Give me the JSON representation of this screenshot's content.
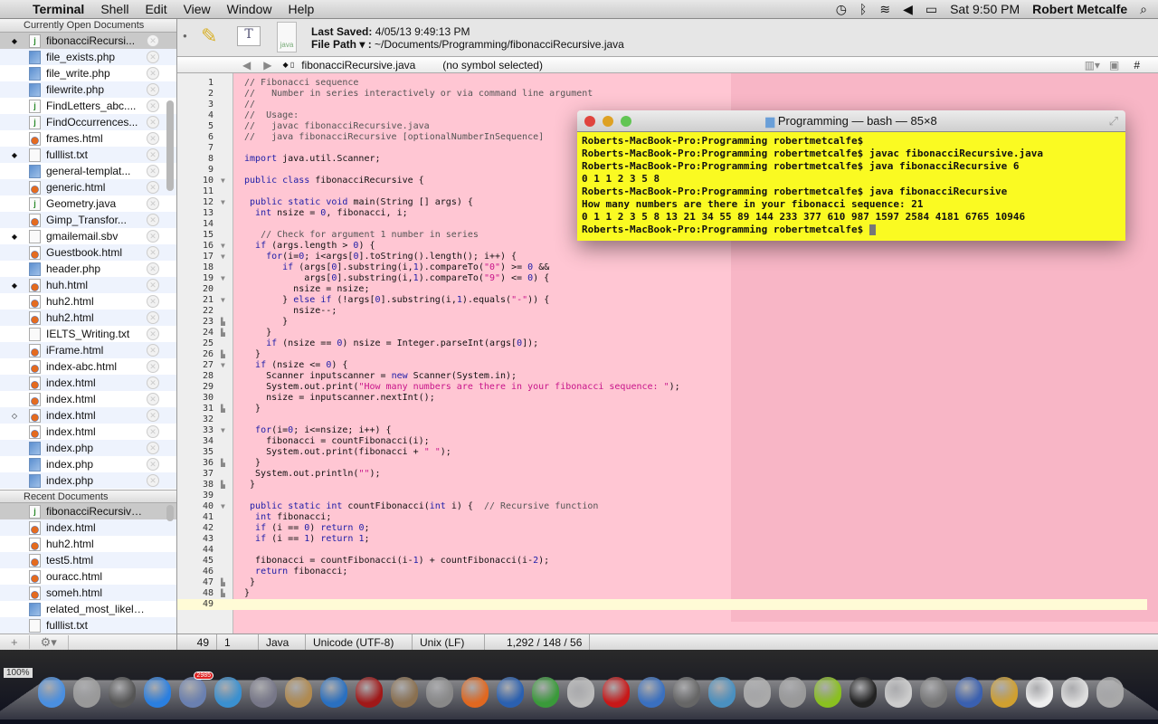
{
  "menubar": {
    "app": "Terminal",
    "items": [
      "Shell",
      "Edit",
      "View",
      "Window",
      "Help"
    ],
    "clock": "Sat 9:50 PM",
    "user": "Robert Metcalfe"
  },
  "sidebar": {
    "open_header": "Currently Open Documents",
    "open_docs": [
      {
        "name": "fibonacciRecursi...",
        "type": "java",
        "mark": "◆",
        "selected": true
      },
      {
        "name": "file_exists.php",
        "type": "php",
        "mark": ""
      },
      {
        "name": "file_write.php",
        "type": "php",
        "mark": ""
      },
      {
        "name": "filewrite.php",
        "type": "php",
        "mark": ""
      },
      {
        "name": "FindLetters_abc....",
        "type": "java",
        "mark": ""
      },
      {
        "name": "FindOccurrences...",
        "type": "java",
        "mark": ""
      },
      {
        "name": "frames.html",
        "type": "html",
        "mark": ""
      },
      {
        "name": "fulllist.txt",
        "type": "txt",
        "mark": "◆"
      },
      {
        "name": "general-templat...",
        "type": "php",
        "mark": ""
      },
      {
        "name": "generic.html",
        "type": "html",
        "mark": ""
      },
      {
        "name": "Geometry.java",
        "type": "java",
        "mark": ""
      },
      {
        "name": "Gimp_Transfor...",
        "type": "html",
        "mark": ""
      },
      {
        "name": "gmailemail.sbv",
        "type": "txt",
        "mark": "◆"
      },
      {
        "name": "Guestbook.html",
        "type": "html",
        "mark": ""
      },
      {
        "name": "header.php",
        "type": "php",
        "mark": ""
      },
      {
        "name": "huh.html",
        "type": "html",
        "mark": "◆"
      },
      {
        "name": "huh2.html",
        "type": "html",
        "mark": ""
      },
      {
        "name": "huh2.html",
        "type": "html",
        "mark": ""
      },
      {
        "name": "IELTS_Writing.txt",
        "type": "txt",
        "mark": ""
      },
      {
        "name": "iFrame.html",
        "type": "html",
        "mark": ""
      },
      {
        "name": "index-abc.html",
        "type": "html",
        "mark": ""
      },
      {
        "name": "index.html",
        "type": "html",
        "mark": ""
      },
      {
        "name": "index.html",
        "type": "html",
        "mark": ""
      },
      {
        "name": "index.html",
        "type": "html",
        "mark": "◇"
      },
      {
        "name": "index.html",
        "type": "html",
        "mark": ""
      },
      {
        "name": "index.php",
        "type": "php",
        "mark": ""
      },
      {
        "name": "index.php",
        "type": "php",
        "mark": ""
      },
      {
        "name": "index.php",
        "type": "php",
        "mark": ""
      }
    ],
    "recent_header": "Recent Documents",
    "recent_docs": [
      {
        "name": "fibonacciRecursive.j...",
        "type": "java",
        "selected": true
      },
      {
        "name": "index.html",
        "type": "html"
      },
      {
        "name": "huh2.html",
        "type": "html"
      },
      {
        "name": "test5.html",
        "type": "html"
      },
      {
        "name": "ouracc.html",
        "type": "html"
      },
      {
        "name": "someh.html",
        "type": "html"
      },
      {
        "name": "related_most_likely_...",
        "type": "php"
      },
      {
        "name": "fulllist.txt",
        "type": "txt"
      }
    ],
    "footer": {
      "add": "+",
      "gear": "⚙▾"
    }
  },
  "toolbar": {
    "last_saved_label": "Last Saved:",
    "last_saved": "4/05/13 9:49:13 PM",
    "file_path_label": "File Path ▾ :",
    "file_path": "~/Documents/Programming/fibonacciRecursive.java",
    "file_icon_text": "java"
  },
  "navbar": {
    "file": "fibonacciRecursive.java",
    "symbol": "(no symbol selected)",
    "hash": "#"
  },
  "editor": {
    "bg_color": "#ffc6d3",
    "fold_open": [
      10,
      12,
      16,
      17,
      19,
      21,
      27,
      33,
      40
    ],
    "fold_close": [
      23,
      24,
      26,
      31,
      36,
      38,
      47,
      48
    ],
    "current_line": 49,
    "lines": [
      "// Fibonacci sequence",
      "//   Number in series interactively or via command line argument",
      "//",
      "//  Usage:",
      "//   javac fibonacciRecursive.java",
      "//   java fibonacciRecursive [optionalNumberInSequence]",
      "",
      "import java.util.Scanner;",
      "",
      "public class fibonacciRecursive {",
      "",
      " public static void main(String [] args) {",
      "  int nsize = 0, fibonacci, i;",
      "",
      "   // Check for argument 1 number in series",
      "  if (args.length > 0) {",
      "    for(i=0; i<args[0].toString().length(); i++) {",
      "       if (args[0].substring(i,1).compareTo(\"0\") >= 0 &&",
      "           args[0].substring(i,1).compareTo(\"9\") <= 0) {",
      "         nsize = nsize;",
      "       } else if (!args[0].substring(i,1).equals(\"-\")) {",
      "         nsize--;",
      "       }",
      "    }",
      "    if (nsize == 0) nsize = Integer.parseInt(args[0]);",
      "  }",
      "  if (nsize <= 0) {",
      "    Scanner inputscanner = new Scanner(System.in);",
      "    System.out.print(\"How many numbers are there in your fibonacci sequence: \");",
      "    nsize = inputscanner.nextInt();",
      "  }",
      "",
      "  for(i=0; i<=nsize; i++) {",
      "    fibonacci = countFibonacci(i);",
      "    System.out.print(fibonacci + \" \");",
      "  }",
      "  System.out.println(\"\");",
      " }",
      "",
      " public static int countFibonacci(int i) {  // Recursive function",
      "  int fibonacci;",
      "  if (i == 0) return 0;",
      "  if (i == 1) return 1;",
      "",
      "  fibonacci = countFibonacci(i-1) + countFibonacci(i-2);",
      "  return fibonacci;",
      " }",
      "}",
      ""
    ]
  },
  "status": {
    "line": "49",
    "col": "1",
    "language": "Java",
    "encoding": "Unicode (UTF-8)",
    "line_endings": "Unix (LF)",
    "counts": "1,292 / 148 / 56"
  },
  "terminal": {
    "title": "Programming — bash — 85×8",
    "bg_color": "#fafa22",
    "lines": [
      "Roberts-MacBook-Pro:Programming robertmetcalfe$",
      "Roberts-MacBook-Pro:Programming robertmetcalfe$ javac fibonacciRecursive.java",
      "Roberts-MacBook-Pro:Programming robertmetcalfe$ java fibonacciRecursive 6",
      "0 1 1 2 3 5 8",
      "Roberts-MacBook-Pro:Programming robertmetcalfe$ java fibonacciRecursive",
      "How many numbers are there in your fibonacci sequence: 21",
      "0 1 1 2 3 5 8 13 21 34 55 89 144 233 377 610 987 1597 2584 4181 6765 10946",
      "Roberts-MacBook-Pro:Programming robertmetcalfe$ "
    ]
  },
  "dock": {
    "zoom": "100%",
    "badge": "2985",
    "apps": [
      {
        "name": "finder",
        "color": "#4a8fe0"
      },
      {
        "name": "launchpad",
        "color": "#999"
      },
      {
        "name": "app",
        "color": "#555"
      },
      {
        "name": "app-store",
        "color": "#2a7fe0"
      },
      {
        "name": "mail-stamp",
        "color": "#6a80b0",
        "badge": true
      },
      {
        "name": "safari",
        "color": "#3a90d0"
      },
      {
        "name": "facetime",
        "color": "#778"
      },
      {
        "name": "address-book",
        "color": "#b08a50"
      },
      {
        "name": "itunes",
        "color": "#2a70c0"
      },
      {
        "name": "photo-booth",
        "color": "#a01818"
      },
      {
        "name": "iphoto",
        "color": "#8a7050"
      },
      {
        "name": "system-preferences",
        "color": "#888"
      },
      {
        "name": "firefox",
        "color": "#e06820"
      },
      {
        "name": "filezilla",
        "color": "#2a60b0"
      },
      {
        "name": "chrome",
        "color": "#3a9a3a"
      },
      {
        "name": "scissors-app",
        "color": "#bbb"
      },
      {
        "name": "opera",
        "color": "#c81818"
      },
      {
        "name": "xcode",
        "color": "#3a70c0"
      },
      {
        "name": "gimp",
        "color": "#666"
      },
      {
        "name": "preview",
        "color": "#4a90c0"
      },
      {
        "name": "help",
        "color": "#aaa"
      },
      {
        "name": "eclipse",
        "color": "#999"
      },
      {
        "name": "brackets",
        "color": "#8ac020"
      },
      {
        "name": "terminal",
        "color": "#222"
      },
      {
        "name": "automator",
        "color": "#ccc"
      },
      {
        "name": "app",
        "color": "#777"
      },
      {
        "name": "quicktime",
        "color": "#3a60b0"
      },
      {
        "name": "textwrangler",
        "color": "#d0a030"
      },
      {
        "name": "document",
        "color": "#eee"
      },
      {
        "name": "window",
        "color": "#ddd"
      },
      {
        "name": "trash",
        "color": "#aaa"
      }
    ]
  }
}
